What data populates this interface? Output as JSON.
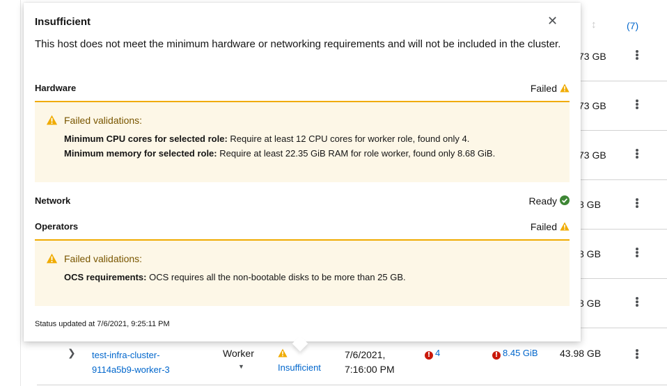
{
  "table": {
    "header_count": "(7)",
    "rows": [
      {
        "disk": "73 GB"
      },
      {
        "disk": "73 GB"
      },
      {
        "disk": "73 GB"
      },
      {
        "disk": "8 GB"
      },
      {
        "disk": "8 GB"
      },
      {
        "disk": "8 GB"
      }
    ],
    "host": {
      "hostname": "test-infra-cluster-9114a5b9-worker-3",
      "role": "Worker",
      "status": "Insufficient",
      "discovered": "7/6/2021, 7:16:00 PM",
      "cpu": "4",
      "memory": "8.45 GiB",
      "disk": "43.98 GB"
    }
  },
  "popover": {
    "title": "Insufficient",
    "description": "This host does not meet the minimum hardware or networking requirements and will not be included in the cluster.",
    "hardware": {
      "name": "Hardware",
      "state": "Failed",
      "alert_title": "Failed validations:",
      "lines": [
        {
          "label": "Minimum CPU cores for selected role:",
          "text": " Require at least 12 CPU cores for worker role, found only 4."
        },
        {
          "label": "Minimum memory for selected role:",
          "text": " Require at least 22.35 GiB RAM for role worker, found only 8.68 GiB."
        }
      ]
    },
    "network": {
      "name": "Network",
      "state": "Ready"
    },
    "operators": {
      "name": "Operators",
      "state": "Failed",
      "alert_title": "Failed validations:",
      "lines": [
        {
          "label": "OCS requirements:",
          "text": " OCS requires all the non-bootable disks to be more than 25 GB."
        }
      ]
    },
    "status_updated": "Status updated at 7/6/2021, 9:25:11 PM"
  },
  "colors": {
    "link": "#0066cc",
    "warning": "#f0ab00",
    "success": "#3e8635",
    "danger": "#c9190b",
    "alert_bg": "#fdf7e7"
  },
  "icons": [
    "sort-icon",
    "kebab-icon",
    "close-icon",
    "warning-icon",
    "check-circle-icon",
    "error-circle-icon",
    "chevron-right-icon",
    "caret-down-icon"
  ]
}
